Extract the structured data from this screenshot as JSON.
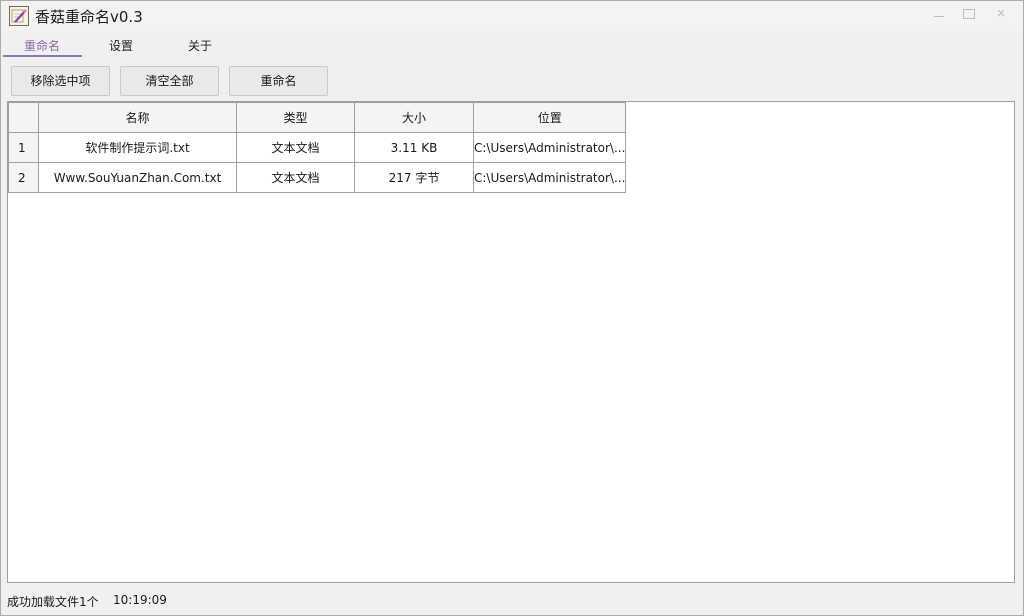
{
  "window": {
    "title": "香菇重命名v0.3"
  },
  "tabs": [
    {
      "label": "重命名",
      "active": true
    },
    {
      "label": "设置",
      "active": false
    },
    {
      "label": "关于",
      "active": false
    }
  ],
  "toolbar": {
    "remove_label": "移除选中项",
    "clear_label": "清空全部",
    "rename_label": "重命名"
  },
  "table": {
    "columns": [
      "名称",
      "类型",
      "大小",
      "位置"
    ],
    "rows": [
      {
        "index": "1",
        "name": "软件制作提示词.txt",
        "type": "文本文档",
        "size": "3.11 KB",
        "path": "C:\\Users\\Administrator\\..."
      },
      {
        "index": "2",
        "name": "Www.SouYuanZhan.Com.txt",
        "type": "文本文档",
        "size": "217 字节",
        "path": "C:\\Users\\Administrator\\..."
      }
    ]
  },
  "status": {
    "message": "成功加载文件1个",
    "time": "10:19:09"
  },
  "colors": {
    "accent": "#8d76b8",
    "window_bg": "#f0f0f0",
    "table_bg": "#ffffff"
  },
  "icons": {
    "app": "pencil-paper-icon",
    "minimize": "minimize-icon",
    "maximize": "maximize-icon",
    "close": "close-icon"
  }
}
